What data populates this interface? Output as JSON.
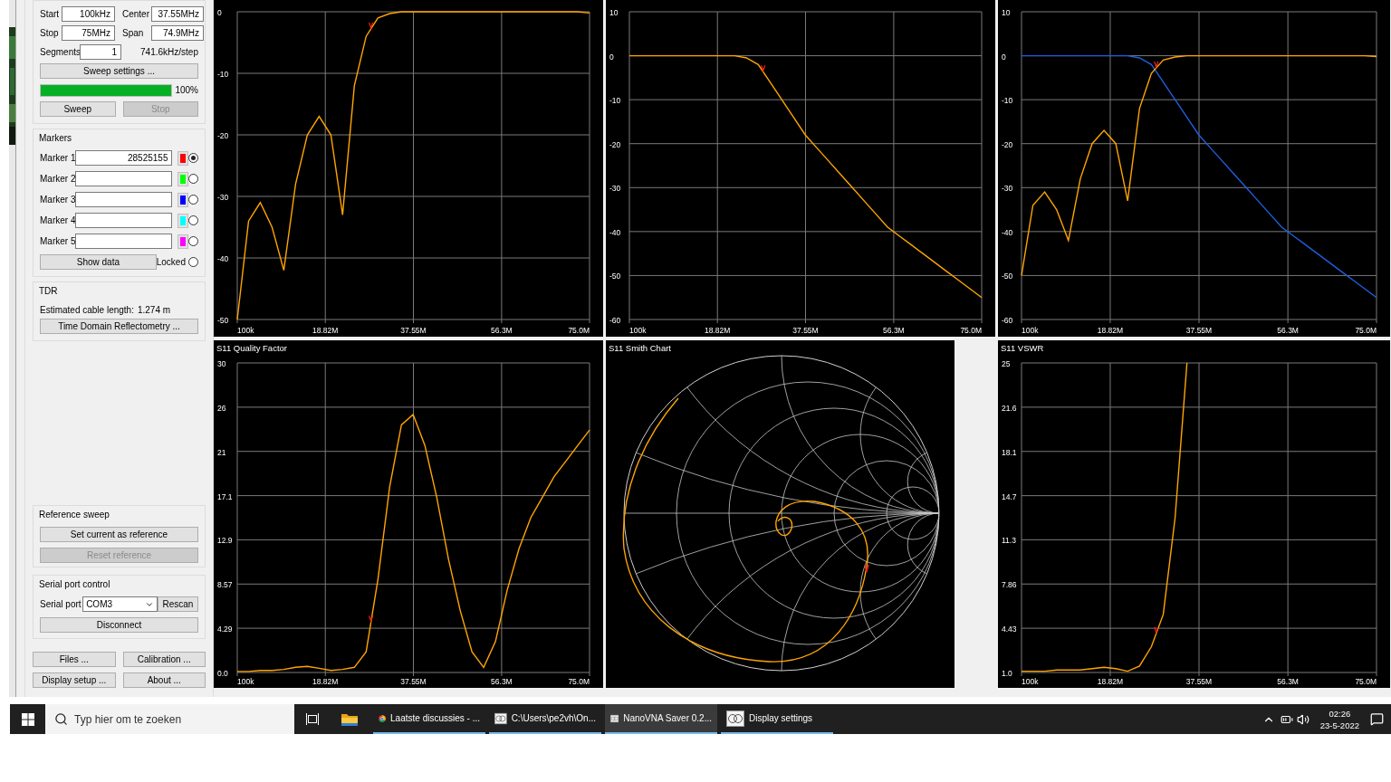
{
  "sweep": {
    "start_label": "Start",
    "start": "100kHz",
    "stop_label": "Stop",
    "stop": "75MHz",
    "center_label": "Center",
    "center": "37.55MHz",
    "span_label": "Span",
    "span": "74.9MHz",
    "segments_label": "Segments",
    "segments": "1",
    "step": "741.6kHz/step",
    "settings_button": "Sweep settings ...",
    "progress": {
      "level": 1.0,
      "reading": "100%"
    },
    "sweep_button": {
      "label": "Sweep",
      "disabled": false
    },
    "stop_button": {
      "label": "Stop",
      "disabled": true
    }
  },
  "markers": {
    "title": "Markers",
    "items": [
      {
        "label": "Marker 1",
        "value": "28525155",
        "color": "#ff0000",
        "selected": true
      },
      {
        "label": "Marker 2",
        "color": "#00ff00",
        "selected": false
      },
      {
        "label": "Marker 3",
        "color": "#0000ff",
        "selected": false
      },
      {
        "label": "Marker 4",
        "color": "#00ffff",
        "selected": false
      },
      {
        "label": "Marker 5",
        "color": "#ff00ff",
        "selected": false
      }
    ],
    "show_data_button": "Show data",
    "locked": {
      "label": "Locked",
      "checked": false
    }
  },
  "tdr": {
    "title": "TDR",
    "cable_label": "Estimated cable length:",
    "cable_value": "1.274 m",
    "button": "Time Domain Reflectometry ..."
  },
  "reference_sweep": {
    "title": "Reference sweep",
    "buttons": [
      {
        "label": "Set current as reference",
        "disabled": false
      },
      {
        "label": "Reset reference",
        "disabled": true
      }
    ]
  },
  "serial_port": {
    "title": "Serial port control",
    "label": "Serial port",
    "port": "COM3",
    "rescan_button": "Rescan",
    "disconnect_button": "Disconnect"
  },
  "bottom_buttons": [
    "Files ...",
    "Calibration ...",
    "Display setup ...",
    "About ..."
  ],
  "charts": [
    {
      "kind": "line",
      "chart_data": {
        "type": "line",
        "grid": true,
        "x": [
          100000,
          2500000,
          5000000,
          7500000,
          10000000,
          12500000,
          15000000,
          17500000,
          20000000,
          22500000,
          25000000,
          27500000,
          30000000,
          32500000,
          35000000,
          37500000,
          40000000,
          42500000,
          45000000,
          47500000,
          50000000,
          52500000,
          55000000,
          57500000,
          60000000,
          62500000,
          65000000,
          67500000,
          70000000,
          72500000,
          75000000
        ],
        "xlim": [
          100000,
          75000000
        ],
        "ylim": [
          -50,
          0
        ],
        "xticks": [
          {
            "value": 100000,
            "label": "100k"
          },
          {
            "value": 18820000,
            "label": "18.82M"
          },
          {
            "value": 37550000,
            "label": "37.55M"
          },
          {
            "value": 56300000,
            "label": "56.3M"
          },
          {
            "value": 75000000,
            "label": "75.0M"
          }
        ],
        "yticks": [
          0,
          -10,
          -20,
          -30,
          -40,
          -50
        ],
        "series": [
          {
            "color": "#ffa500",
            "values": [
              -50,
              -34,
              -31,
              -35,
              -42,
              -28,
              -20,
              -17,
              -20,
              -33,
              -12,
              -4,
              -1,
              -0.3,
              0,
              0,
              0,
              0,
              0,
              0,
              0,
              0,
              0,
              0,
              0,
              0,
              0,
              0,
              0,
              0,
              -0.2
            ]
          }
        ]
      }
    },
    {
      "kind": "line",
      "chart_data": {
        "type": "line",
        "grid": true,
        "x": [
          100000,
          2500000,
          5000000,
          7500000,
          10000000,
          12500000,
          15000000,
          17500000,
          20000000,
          22500000,
          25000000,
          27500000,
          30000000,
          32500000,
          35000000,
          37500000,
          40000000,
          42500000,
          45000000,
          47500000,
          50000000,
          52500000,
          55000000,
          57500000,
          60000000,
          62500000,
          65000000,
          67500000,
          70000000,
          72500000,
          75000000
        ],
        "xlim": [
          100000,
          75000000
        ],
        "ylim": [
          -60,
          10
        ],
        "xticks": [
          {
            "value": 100000,
            "label": "100k"
          },
          {
            "value": 18820000,
            "label": "18.82M"
          },
          {
            "value": 37550000,
            "label": "37.55M"
          },
          {
            "value": 56300000,
            "label": "56.3M"
          },
          {
            "value": 75000000,
            "label": "75.0M"
          }
        ],
        "yticks": [
          10,
          0,
          -10,
          -20,
          -30,
          -40,
          -50,
          -60
        ],
        "series": [
          {
            "color": "#ffa500",
            "values": [
              0,
              0,
              0,
              0,
              0,
              0,
              0,
              0,
              0,
              0,
              -0.5,
              -2,
              -6,
              -10,
              -14,
              -18,
              -21,
              -24,
              -27,
              -30,
              -33,
              -36,
              -39,
              -41,
              -43,
              -45,
              -47,
              -49,
              -51,
              -53,
              -55
            ]
          }
        ]
      }
    },
    {
      "kind": "line",
      "chart_data": {
        "type": "line",
        "grid": true,
        "x": [
          100000,
          2500000,
          5000000,
          7500000,
          10000000,
          12500000,
          15000000,
          17500000,
          20000000,
          22500000,
          25000000,
          27500000,
          30000000,
          32500000,
          35000000,
          37500000,
          40000000,
          42500000,
          45000000,
          47500000,
          50000000,
          52500000,
          55000000,
          57500000,
          60000000,
          62500000,
          65000000,
          67500000,
          70000000,
          72500000,
          75000000
        ],
        "xlim": [
          100000,
          75000000
        ],
        "ylim": [
          -60,
          10
        ],
        "xticks": [
          {
            "value": 100000,
            "label": "100k"
          },
          {
            "value": 18820000,
            "label": "18.82M"
          },
          {
            "value": 37550000,
            "label": "37.55M"
          },
          {
            "value": 56300000,
            "label": "56.3M"
          },
          {
            "value": 75000000,
            "label": "75.0M"
          }
        ],
        "yticks": [
          10,
          0,
          -10,
          -20,
          -30,
          -40,
          -50,
          -60
        ],
        "series": [
          {
            "color": "#1f5fe0",
            "values": [
              0,
              0,
              0,
              0,
              0,
              0,
              0,
              0,
              0,
              0,
              -0.5,
              -2,
              -6,
              -10,
              -14,
              -18,
              -21,
              -24,
              -27,
              -30,
              -33,
              -36,
              -39,
              -41,
              -43,
              -45,
              -47,
              -49,
              -51,
              -53,
              -55
            ]
          },
          {
            "color": "#ffa500",
            "values": [
              -50,
              -34,
              -31,
              -35,
              -42,
              -28,
              -20,
              -17,
              -20,
              -33,
              -12,
              -4,
              -1,
              -0.3,
              0,
              0,
              0,
              0,
              0,
              0,
              0,
              0,
              0,
              0,
              0,
              0,
              0,
              0,
              0,
              0,
              -0.2
            ]
          }
        ]
      }
    },
    {
      "kind": "line",
      "chart_data": {
        "type": "line",
        "grid": true,
        "title": "S11 Quality Factor",
        "x": [
          100000,
          2500000,
          5000000,
          7500000,
          10000000,
          12500000,
          15000000,
          17500000,
          20000000,
          22500000,
          25000000,
          27500000,
          30000000,
          32500000,
          35000000,
          37500000,
          40000000,
          42500000,
          45000000,
          47500000,
          50000000,
          52500000,
          55000000,
          57500000,
          60000000,
          62500000,
          65000000,
          67500000,
          70000000,
          72500000,
          75000000
        ],
        "xlim": [
          100000,
          75000000
        ],
        "ylim": [
          0,
          30
        ],
        "xticks": [
          {
            "value": 100000,
            "label": "100k"
          },
          {
            "value": 18820000,
            "label": "18.82M"
          },
          {
            "value": 37550000,
            "label": "37.55M"
          },
          {
            "value": 56300000,
            "label": "56.3M"
          },
          {
            "value": 75000000,
            "label": "75.0M"
          }
        ],
        "yticks": [
          {
            "value": 30,
            "label": "30"
          },
          {
            "value": 25.71,
            "label": "26"
          },
          {
            "value": 21.43,
            "label": "21"
          },
          {
            "value": 17.14,
            "label": "17.1"
          },
          {
            "value": 12.86,
            "label": "12.9"
          },
          {
            "value": 8.57,
            "label": "8.57"
          },
          {
            "value": 4.29,
            "label": "4.29"
          },
          {
            "value": 0,
            "label": "0.0"
          }
        ],
        "series": [
          {
            "color": "#ffa500",
            "values": [
              0.1,
              0.1,
              0.2,
              0.2,
              0.3,
              0.5,
              0.6,
              0.4,
              0.2,
              0.3,
              0.5,
              2,
              9,
              18,
              24,
              25,
              22,
              17,
              11,
              6,
              2,
              0.5,
              3,
              8,
              12,
              15,
              17,
              19,
              20.5,
              22,
              23.5
            ]
          }
        ]
      }
    },
    {
      "kind": "smith",
      "title": "S11 Smith Chart"
    },
    {
      "kind": "line",
      "chart_data": {
        "type": "line",
        "grid": true,
        "title": "S11 VSWR",
        "x": [
          100000,
          2500000,
          5000000,
          7500000,
          10000000,
          12500000,
          15000000,
          17500000,
          20000000,
          22500000,
          25000000,
          27500000,
          30000000,
          32500000,
          35000000
        ],
        "xlim": [
          100000,
          75000000
        ],
        "ylim": [
          1,
          25
        ],
        "xticks": [
          {
            "value": 100000,
            "label": "100k"
          },
          {
            "value": 18820000,
            "label": "18.82M"
          },
          {
            "value": 37550000,
            "label": "37.55M"
          },
          {
            "value": 56300000,
            "label": "56.3M"
          },
          {
            "value": 75000000,
            "label": "75.0M"
          }
        ],
        "yticks": [
          {
            "value": 25,
            "label": "25"
          },
          {
            "value": 21.57,
            "label": "21.6"
          },
          {
            "value": 18.14,
            "label": "18.1"
          },
          {
            "value": 14.71,
            "label": "14.7"
          },
          {
            "value": 11.29,
            "label": "11.3"
          },
          {
            "value": 7.86,
            "label": "7.86"
          },
          {
            "value": 4.43,
            "label": "4.43"
          },
          {
            "value": 1,
            "label": "1.0"
          }
        ],
        "series": [
          {
            "color": "#ffa500",
            "values": [
              1.1,
              1.1,
              1.1,
              1.2,
              1.2,
              1.2,
              1.3,
              1.4,
              1.3,
              1.1,
              1.5,
              3,
              5.5,
              13,
              25
            ]
          }
        ]
      }
    }
  ],
  "taskbar": {
    "search": {
      "placeholder": "Typ hier om te zoeken"
    },
    "apps": [
      {
        "kind": "chrome",
        "label": "Laatste discussies - ...",
        "selected": false
      },
      {
        "kind": "app",
        "label": "C:\\Users\\pe2vh\\On...",
        "selected": false
      },
      {
        "kind": "app",
        "label": "NanoVNA Saver 0.2...",
        "selected": true
      },
      {
        "kind": "app",
        "label": "Display settings",
        "selected": false
      }
    ],
    "time": "02:26",
    "date": "23-5-2022"
  }
}
